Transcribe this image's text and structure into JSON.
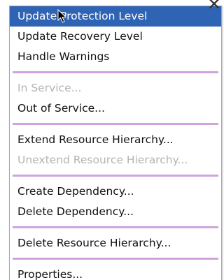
{
  "menu": {
    "items": [
      {
        "label": "Update Protection Level",
        "state": "selected"
      },
      {
        "label": "Update Recovery Level",
        "state": "normal"
      },
      {
        "label": "Handle Warnings",
        "state": "normal"
      },
      {
        "label": "In Service...",
        "state": "disabled"
      },
      {
        "label": "Out of Service...",
        "state": "normal"
      },
      {
        "label": "Extend Resource Hierarchy...",
        "state": "normal"
      },
      {
        "label": "Unextend Resource Hierarchy...",
        "state": "disabled"
      },
      {
        "label": "Create Dependency...",
        "state": "normal"
      },
      {
        "label": "Delete Dependency...",
        "state": "normal"
      },
      {
        "label": "Delete Resource Hierarchy...",
        "state": "normal"
      },
      {
        "label": "Properties...",
        "state": "normal"
      }
    ]
  },
  "colors": {
    "selection": "#2f63b3",
    "separator": "#cfa4de",
    "disabled_text": "#b4b4b4"
  },
  "icons": {
    "corner": "close-icon",
    "pointer": "mouse-cursor-icon"
  }
}
